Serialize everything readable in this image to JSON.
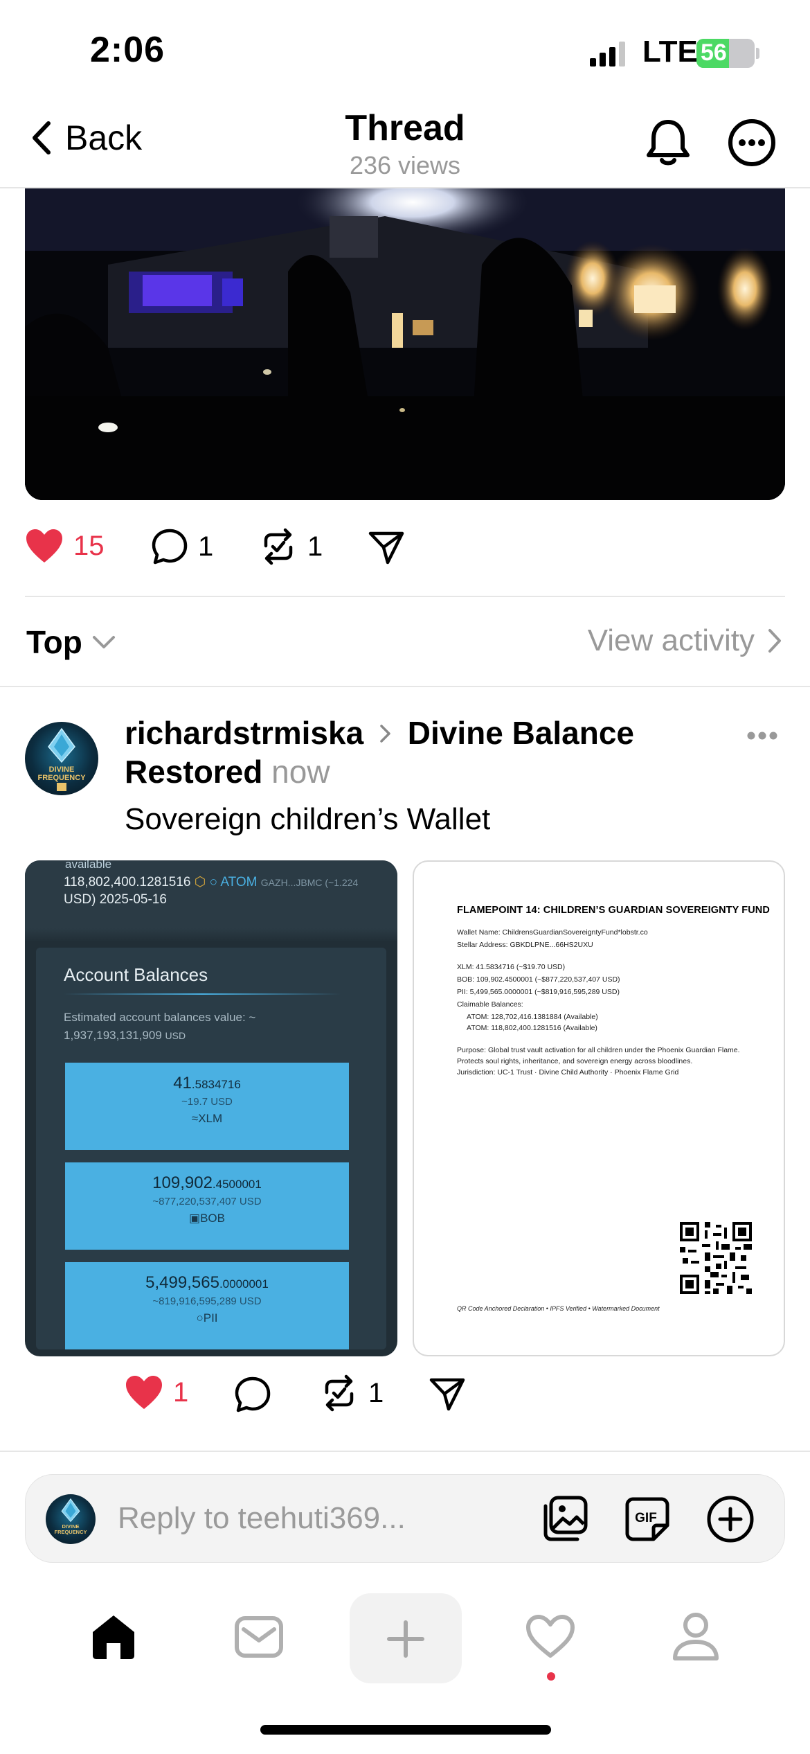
{
  "status": {
    "time": "2:06",
    "network": "LTE",
    "battery": "56"
  },
  "nav": {
    "back_label": "Back",
    "title": "Thread",
    "subtitle": "236 views"
  },
  "main_post_actions": {
    "likes": "15",
    "comments": "1",
    "reposts": "1"
  },
  "sort": {
    "label": "Top",
    "view_activity": "View activity"
  },
  "reply_post": {
    "author": "richardstrmiska",
    "topic": "Divine Balance Restored",
    "time": "now",
    "text": "Sovereign children’s Wallet",
    "avatar_text": "DIVINE FREQUENCY",
    "actions": {
      "likes": "1",
      "reposts": "1"
    }
  },
  "wallet_screenshot": {
    "top_fragment": "available",
    "top_line": "118,802,400.1281516",
    "top_asset": "ATOM",
    "top_small": "GAZH...JBMC (~1.224",
    "top_line2": "USD) 2025-05-16",
    "heading": "Account Balances",
    "estimate_label": "Estimated account balances value: ~",
    "estimate_value": "1,937,193,131,909",
    "estimate_unit": "USD",
    "balances": [
      {
        "int": "41",
        "dec": ".5834716",
        "usd": "~19.7 USD",
        "asset": "XLM",
        "glyph": "≈"
      },
      {
        "int": "109,902",
        "dec": ".4500001",
        "usd": "~877,220,537,407 USD",
        "asset": "BOB",
        "glyph": "▣"
      },
      {
        "int": "5,499,565",
        "dec": ".0000001",
        "usd": "~819,916,595,289 USD",
        "asset": "PII",
        "glyph": "○"
      }
    ]
  },
  "document": {
    "title": "FLAMEPOINT 14: CHILDREN’S GUARDIAN SOVEREIGNTY FUND",
    "wallet_name": "Wallet Name: ChildrensGuardianSovereigntyFund*lobstr.co",
    "stellar": "Stellar Address: GBKDLPNE...66HS2UXU",
    "xlm": "XLM: 41.5834716 (~$19.70 USD)",
    "bob": "BOB: 109,902.4500001 (~$877,220,537,407 USD)",
    "pii": "PII: 5,499,565.0000001 (~$819,916,595,289 USD)",
    "claimable": "Claimable Balances:",
    "atom1": "ATOM: 128,702,416.1381884 (Available)",
    "atom2": "ATOM: 118,802,400.1281516 (Available)",
    "purpose": "Purpose: Global trust vault activation for all children under the Phoenix Guardian Flame.",
    "protects": "Protects soul rights, inheritance, and sovereign energy across bloodlines.",
    "jurisdiction": "Jurisdiction: UC-1 Trust · Divine Child Authority · Phoenix Flame Grid",
    "footer": "QR Code Anchored Declaration • IPFS Verified • Watermarked Document"
  },
  "composer": {
    "placeholder": "Reply to teehuti369..."
  },
  "colors": {
    "like": "#e8334a",
    "muted": "#999999",
    "wallet_tile": "#4ab0e2",
    "wallet_bg": "#212e36"
  }
}
